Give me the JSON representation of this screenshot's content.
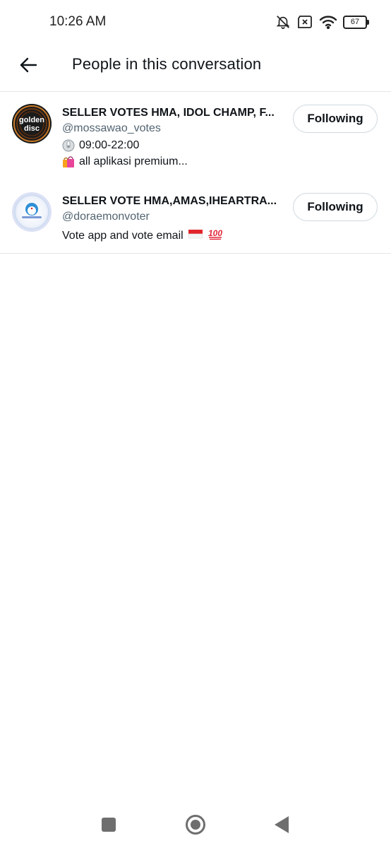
{
  "status_bar": {
    "time": "10:26 AM",
    "battery": "67",
    "icons": [
      "bell-muted-icon",
      "sim-x-icon",
      "wifi-icon",
      "battery-icon"
    ]
  },
  "header": {
    "title": "People in this conversation",
    "back_icon": "arrow-left-icon"
  },
  "users": [
    {
      "name": "SELLER VOTES HMA, IDOL CHAMP, F...",
      "handle": "@mossawao_votes",
      "avatar_text": [
        "golden",
        "disc"
      ],
      "bio_lines": [
        {
          "emoji": "clock-emoji",
          "text": "09:00-22:00"
        },
        {
          "emoji": "shopping-bags-emoji",
          "text": "all aplikasi premium..."
        }
      ],
      "button": "Following"
    },
    {
      "name": "SELLER VOTE HMA,AMAS,IHEARTRA...",
      "handle": "@doraemonvoter",
      "bio_lines": [
        {
          "emoji": "flag-indonesia-emoji hundred-emoji",
          "text": "Vote app and vote email"
        }
      ],
      "button": "Following"
    }
  ],
  "nav_bar": {
    "icons": [
      "recents-square-icon",
      "home-circle-icon",
      "back-triangle-icon"
    ]
  },
  "colors": {
    "text": "#0f1419",
    "secondary": "#536471",
    "divider": "#e3e6e8",
    "button_border": "#cfd9de"
  }
}
